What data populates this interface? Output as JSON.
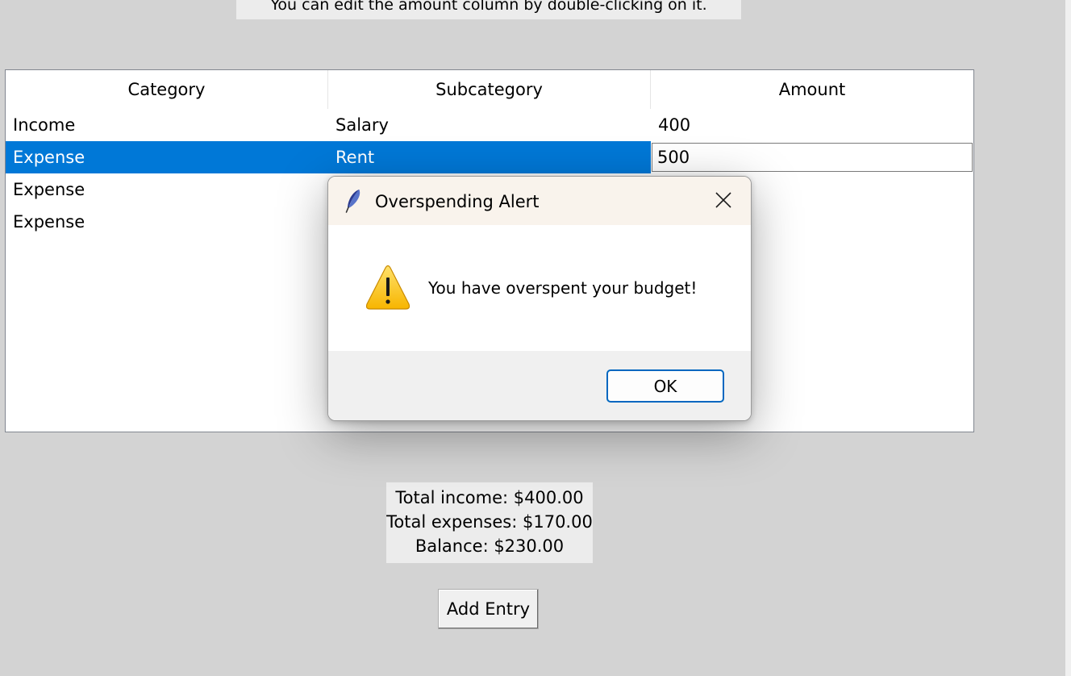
{
  "hint": "You can edit the amount column by double-clicking on it.",
  "table": {
    "columns": [
      "Category",
      "Subcategory",
      "Amount"
    ],
    "rows": [
      {
        "category": "Income",
        "subcategory": "Salary",
        "amount": "400"
      },
      {
        "category": "Expense",
        "subcategory": "Rent",
        "amount": "500"
      },
      {
        "category": "Expense",
        "subcategory": "",
        "amount": ""
      },
      {
        "category": "Expense",
        "subcategory": "",
        "amount": ""
      }
    ],
    "selected_row": 1,
    "editing_value": "500"
  },
  "totals": {
    "income": "Total income: $400.00",
    "expenses": "Total expenses: $170.00",
    "balance": "Balance: $230.00"
  },
  "add_button": "Add Entry",
  "dialog": {
    "title": "Overspending Alert",
    "message": "You have overspent your budget!",
    "ok_label": "OK",
    "icon": "warning-icon",
    "title_icon": "feather-icon",
    "close_icon": "close-icon"
  },
  "colors": {
    "selection": "#0078d7",
    "background": "#d3d3d3",
    "dialog_title_bar": "#f9f3ec",
    "ok_border": "#0067c0",
    "warning_yellow": "#ffc83d"
  }
}
